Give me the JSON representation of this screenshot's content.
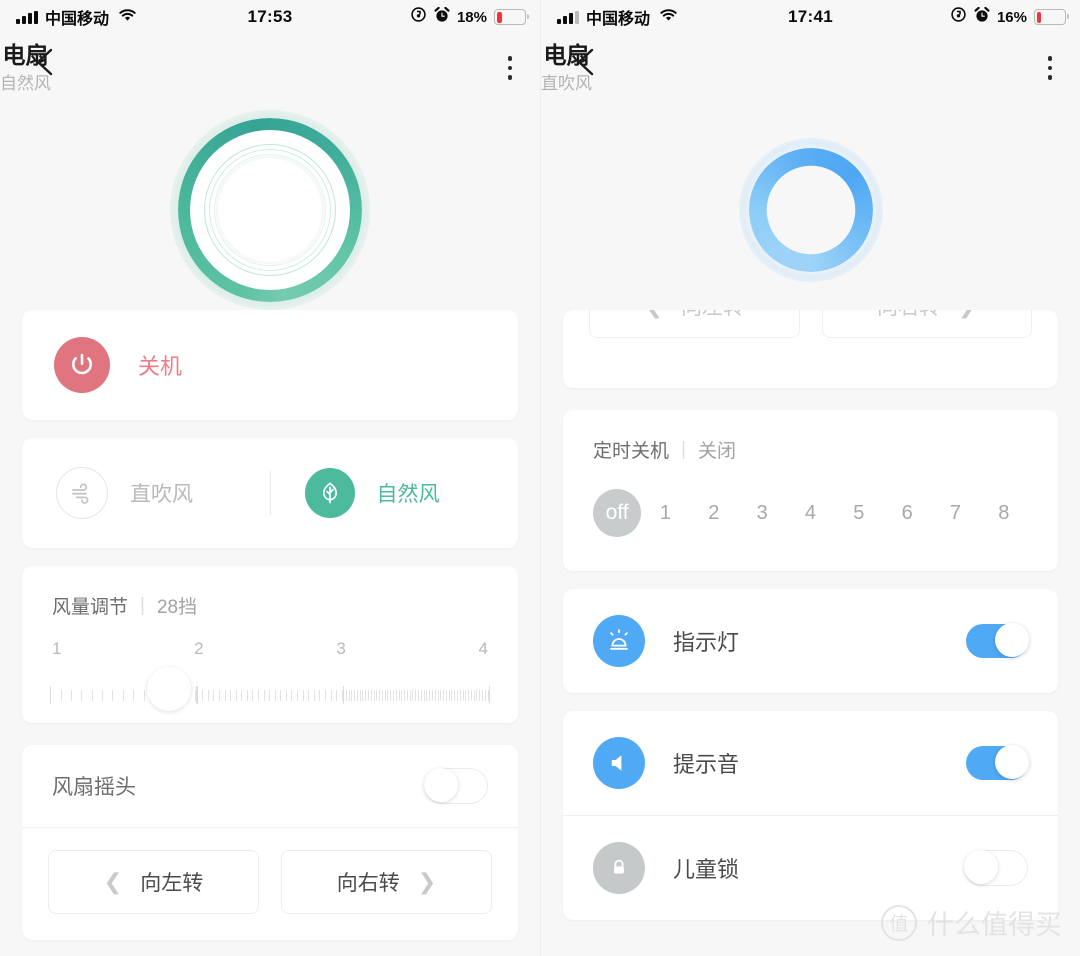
{
  "left": {
    "statusbar": {
      "carrier": "中国移动",
      "time": "17:53",
      "battery_pct": "18%",
      "battery_level": 18,
      "icons": [
        "signal-bars",
        "wifi",
        "rotation-lock",
        "alarm",
        "battery"
      ]
    },
    "nav": {
      "title": "电扇",
      "subtitle": "自然风",
      "back_icon": "chevron-left-icon",
      "more_icon": "kebab-menu-icon"
    },
    "dial": {
      "color": "#4cba9c",
      "state": "on"
    },
    "power": {
      "label": "关机",
      "icon": "power-icon",
      "color": "#e0757f",
      "text_color": "#ed7d86"
    },
    "modes": [
      {
        "label": "直吹风",
        "icon": "wind-icon",
        "active": false
      },
      {
        "label": "自然风",
        "icon": "leaf-icon",
        "active": true
      }
    ],
    "wind": {
      "title": "风量调节",
      "separator": "|",
      "value": "28挡",
      "scale": [
        "1",
        "2",
        "3",
        "4"
      ],
      "thumb_pct": 27
    },
    "swing": {
      "label": "风扇摇头",
      "on": false
    },
    "rotate": {
      "left_label": "向左转",
      "right_label": "向右转",
      "left_icon": "chevron-left-icon",
      "right_icon": "chevron-right-icon"
    }
  },
  "right": {
    "statusbar": {
      "carrier": "中国移动",
      "time": "17:41",
      "battery_pct": "16%",
      "battery_level": 16,
      "icons": [
        "signal-bars",
        "wifi",
        "rotation-lock",
        "alarm",
        "battery"
      ]
    },
    "nav": {
      "title": "电扇",
      "subtitle": "直吹风",
      "back_icon": "chevron-left-icon",
      "more_icon": "kebab-menu-icon"
    },
    "dial": {
      "color": "#5aaef4",
      "state": "on"
    },
    "rotate": {
      "left_label": "向左转",
      "right_label": "向右转",
      "left_icon": "chevron-left-icon",
      "right_icon": "chevron-right-icon"
    },
    "timer": {
      "title": "定时关机",
      "separator": "|",
      "value": "关闭",
      "options": [
        "off",
        "1",
        "2",
        "3",
        "4",
        "5",
        "6",
        "7",
        "8"
      ],
      "selected": "off"
    },
    "settings": [
      {
        "label": "指示灯",
        "icon": "indicator-light-icon",
        "on": true,
        "icon_color": "#50a9f5"
      },
      {
        "label": "提示音",
        "icon": "speaker-icon",
        "on": true,
        "icon_color": "#50a9f5"
      },
      {
        "label": "儿童锁",
        "icon": "lock-icon",
        "on": false,
        "icon_color": "#c6c9ca"
      }
    ],
    "watermark": {
      "badge": "值",
      "text": "什么值得买"
    }
  }
}
